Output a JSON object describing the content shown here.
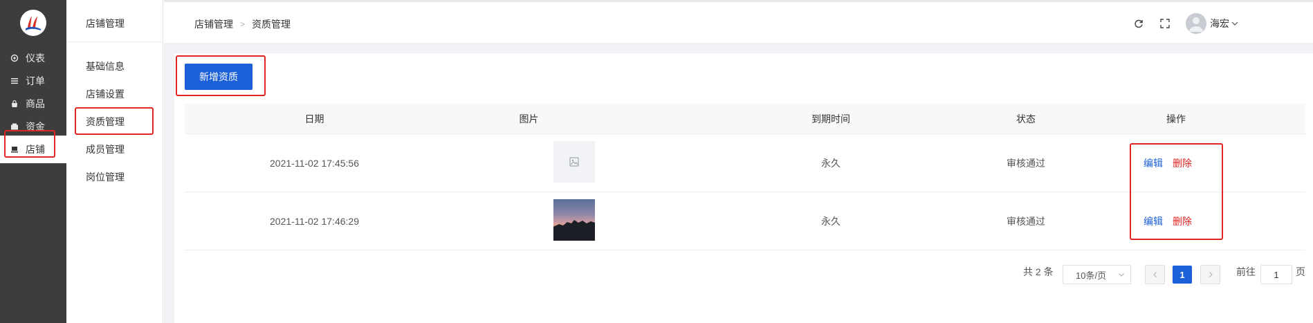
{
  "nav": {
    "items": [
      {
        "label": "仪表",
        "icon": "gauge-icon"
      },
      {
        "label": "订单",
        "icon": "list-icon"
      },
      {
        "label": "商品",
        "icon": "bag-icon"
      },
      {
        "label": "资金",
        "icon": "wallet-icon"
      },
      {
        "label": "店铺",
        "icon": "store-icon"
      }
    ],
    "active_index": 4
  },
  "secondary": {
    "title": "店铺管理",
    "items": [
      {
        "label": "基础信息"
      },
      {
        "label": "店铺设置"
      },
      {
        "label": "资质管理"
      },
      {
        "label": "成员管理"
      },
      {
        "label": "岗位管理"
      }
    ],
    "active_index": 2
  },
  "header": {
    "breadcrumb": [
      "店铺管理",
      "资质管理"
    ],
    "user_name": "海宏"
  },
  "toolbar": {
    "add_label": "新增资质"
  },
  "table": {
    "columns": [
      "日期",
      "图片",
      "到期时间",
      "状态",
      "操作"
    ],
    "rows": [
      {
        "date": "2021-11-02 17:45:56",
        "image": "placeholder",
        "expiry": "永久",
        "status": "审核通过",
        "edit": "编辑",
        "delete": "删除"
      },
      {
        "date": "2021-11-02 17:46:29",
        "image": "photo",
        "expiry": "永久",
        "status": "审核通过",
        "edit": "编辑",
        "delete": "删除"
      }
    ]
  },
  "pagination": {
    "total_label": "共 2 条",
    "page_size_label": "10条/页",
    "current_page": "1",
    "goto_label": "前往",
    "goto_value": "1",
    "page_unit": "页"
  },
  "colors": {
    "primary": "#1b5fd9",
    "danger": "#e02424",
    "sidebar": "#3d3d3d",
    "highlight_box": "#e02424"
  }
}
